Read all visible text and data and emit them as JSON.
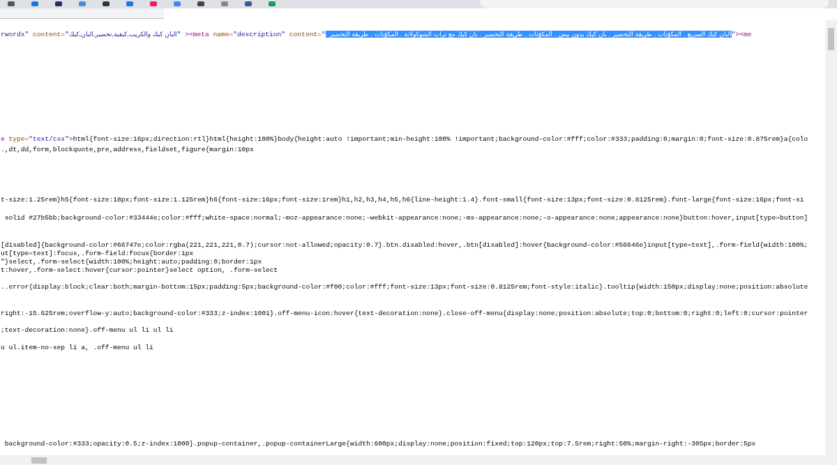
{
  "source_lines": [
    {
      "segments": [
        {
          "kind": "value",
          "text": "rwords\""
        },
        {
          "kind": "attr",
          "text": " content="
        },
        {
          "kind": "value",
          "text": "\""
        },
        {
          "kind": "value_rtl",
          "text": "البان كيك والكريب,كيفية,تحضير,البان,كيك"
        },
        {
          "kind": "value",
          "text": "\""
        },
        {
          "kind": "tag",
          "text": " ><meta"
        },
        {
          "kind": "attr",
          "text": " name="
        },
        {
          "kind": "value",
          "text": "\"description\""
        },
        {
          "kind": "attr",
          "text": " content="
        },
        {
          "kind": "value",
          "text": "\""
        },
        {
          "kind": "selected",
          "text": "البان كيك السريع . المكوّنات . طريقة التحضير . بان كيك بدون بيض . المكوّنات . طريقة التحضير . بان كيك مع تراب الشوكولاتة . المكوّنات . طريقة التحضير ."
        },
        {
          "kind": "value",
          "text": "\""
        },
        {
          "kind": "tag",
          "text": "><me"
        }
      ]
    },
    {
      "segments": [
        {
          "kind": "tag",
          "text": "e"
        },
        {
          "kind": "attr",
          "text": " type="
        },
        {
          "kind": "value",
          "text": "\"text/css\""
        },
        {
          "kind": "tag",
          "text": ">"
        },
        {
          "kind": "text",
          "text": "html{font-size:16px;direction:rtl}html{height:100%}body{height:auto !important;min-height:100% !important;background-color:#fff;color:#333;padding:0;margin:0;font-size:0.875rem}a{colo"
        }
      ]
    },
    {
      "segments": [
        {
          "kind": "text",
          "text": ".,dt,dd,form,blockquote,pre,address,fieldset,figure{margin:10px"
        }
      ]
    },
    {
      "segments": [
        {
          "kind": "text",
          "text": "t-size:1.25rem}h5{font-size:18px;font-size:1.125rem}h6{font-size:16px;font-size:1rem}h1,h2,h3,h4,h5,h6{line-height:1.4}.font-small{font-size:13px;font-size:0.8125rem}.font-large{font-size:16px;font-si"
        }
      ]
    },
    {
      "segments": [
        {
          "kind": "text",
          "text": " solid #27b5bb;background-color:#33444e;color:#fff;white-space:normal;-moz-appearance:none;-webkit-appearance:none;-ms-appearance:none;-o-appearance:none;appearance:none}button:hover,input[type=button]"
        }
      ]
    },
    {
      "segments": [
        {
          "kind": "text",
          "text": "[disabled]{background-color:#66747e;color:rgba(221,221,221,0.7);cursor:not-allowed;opacity:0.7}.btn.disabled:hover,.btn[disabled]:hover{background-color:#56646e}input[type=text],.form-field{width:100%;"
        }
      ]
    },
    {
      "segments": [
        {
          "kind": "text",
          "text": "ut[type=text]:focus,.form-field:focus{border:1px"
        }
      ]
    },
    {
      "segments": [
        {
          "kind": "text",
          "text": "\"}select,.form-select{width:100%;height:auto;padding:0;border:1px"
        }
      ]
    },
    {
      "segments": [
        {
          "kind": "text",
          "text": "t:hover,.form-select:hover{cursor:pointer}select option, .form-select"
        }
      ]
    },
    {
      "segments": [
        {
          "kind": "text",
          "text": "..error{display:block;clear:both;margin-bottom:15px;padding:5px;background-color:#f00;color:#fff;font-size:13px;font-size:0.8125rem;font-style:italic}.tooltip{width:150px;display:none;position:absolute"
        }
      ]
    },
    {
      "segments": [
        {
          "kind": "text",
          "text": "right:-15.625rem;overflow-y:auto;background-color:#333;z-index:1001}.off-menu-icon:hover{text-decoration:none}.close-off-menu{display:none;position:absolute;top:0;bottom:0;right:0;left:0;cursor:pointer"
        }
      ]
    },
    {
      "segments": [
        {
          "kind": "text",
          "text": ";text-decoration:none}.off-menu ul li ul li"
        }
      ]
    },
    {
      "segments": [
        {
          "kind": "text",
          "text": "u ul.item-no-sep li a, .off-menu ul li"
        }
      ]
    },
    {
      "segments": [
        {
          "kind": "text",
          "text": " background-color:#333;opacity:0.5;z-index:1000}.popup-container,.popup-containerLarge{width:600px;display:none;position:fixed;top:120px;top:7.5rem;right:50%;margin-right:-305px;border:5px"
        }
      ]
    }
  ]
}
